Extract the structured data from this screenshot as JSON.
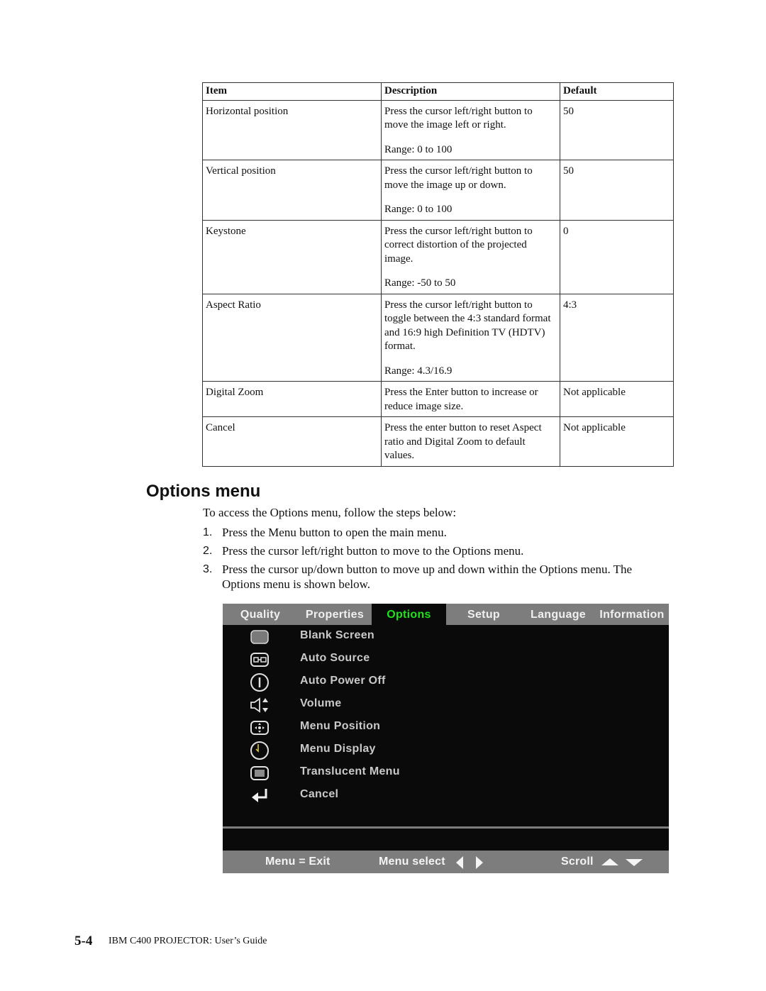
{
  "table": {
    "headers": [
      "Item",
      "Description",
      "Default"
    ],
    "rows": [
      {
        "item": "Horizontal position",
        "description": "Press the cursor left/right button to move the image left or right.",
        "range": "Range: 0 to 100",
        "default": "50"
      },
      {
        "item": "Vertical position",
        "description": "Press the cursor left/right button to move the image up or down.",
        "range": "Range: 0 to 100",
        "default": "50"
      },
      {
        "item": "Keystone",
        "description": "Press the cursor left/right button to correct distortion of the projected image.",
        "range": "Range: -50 to 50",
        "default": "0"
      },
      {
        "item": "Aspect Ratio",
        "description": "Press the cursor left/right button to toggle between the 4:3 standard format and 16:9 high Definition TV (HDTV) format.",
        "range": "Range: 4.3/16.9",
        "default": "4:3"
      },
      {
        "item": "Digital Zoom",
        "description": "Press the Enter button to increase or reduce image size.",
        "range": "",
        "default": "Not applicable"
      },
      {
        "item": "Cancel",
        "description": "Press the enter button to reset Aspect ratio and Digital Zoom to default values.",
        "range": "",
        "default": "Not applicable"
      }
    ]
  },
  "section": {
    "heading": "Options menu",
    "intro": "To access the Options menu, follow the steps below:",
    "steps": [
      {
        "num": "1.",
        "text": "Press the Menu button to open the main menu."
      },
      {
        "num": "2.",
        "text": "Press the cursor left/right button to move to the Options menu."
      },
      {
        "num": "3.",
        "text": "Press the cursor up/down button to move up and down within the Options menu. The Options menu is shown below."
      }
    ]
  },
  "osd": {
    "tabs": [
      {
        "label": "Quality",
        "active": false
      },
      {
        "label": "Properties",
        "active": false
      },
      {
        "label": "Options",
        "active": true
      },
      {
        "label": "Setup",
        "active": false
      },
      {
        "label": "Language",
        "active": false
      },
      {
        "label": "Information",
        "active": false
      }
    ],
    "items": [
      {
        "label": "Blank Screen",
        "icon": "blank-screen-icon"
      },
      {
        "label": "Auto Source",
        "icon": "auto-source-icon"
      },
      {
        "label": "Auto Power Off",
        "icon": "power-icon"
      },
      {
        "label": "Volume",
        "icon": "volume-icon"
      },
      {
        "label": "Menu Position",
        "icon": "menu-position-icon"
      },
      {
        "label": "Menu Display",
        "icon": "clock-icon"
      },
      {
        "label": "Translucent Menu",
        "icon": "translucent-icon"
      },
      {
        "label": "Cancel",
        "icon": "enter-return-icon"
      }
    ],
    "footer": {
      "exit": "Menu = Exit",
      "select": "Menu select",
      "scroll": "Scroll"
    },
    "colors": {
      "active_tab_text": "#22e01c",
      "bar": "#7d7d7d",
      "background": "#0a0a0a"
    }
  },
  "footer": {
    "page_number": "5-4",
    "title": "IBM C400 PROJECTOR: User’s Guide"
  }
}
